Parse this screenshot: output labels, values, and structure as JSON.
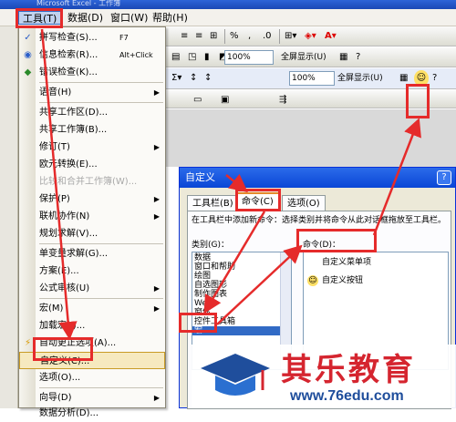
{
  "window": {
    "title": "Microsoft Excel - 工作簿"
  },
  "menubar": {
    "tools": "工具(T)",
    "data": "数据(D)",
    "window": "窗口(W)",
    "help": "帮助(H)"
  },
  "toolbar": {
    "zoom": "100%",
    "fullscreen": "全屏显示(U)"
  },
  "menu": {
    "spelling": {
      "label": "拼写检查(S)...",
      "shortcut": "F7"
    },
    "research": {
      "label": "信息检索(R)...",
      "shortcut": "Alt+Click"
    },
    "error_check": {
      "label": "错误检查(K)..."
    },
    "speech": {
      "label": "语音(H)"
    },
    "shared_workspace": {
      "label": "共享工作区(D)..."
    },
    "share_workbook": {
      "label": "共享工作簿(B)..."
    },
    "track_changes": {
      "label": "修订(T)"
    },
    "ocr": {
      "label": "欧元转换(E)..."
    },
    "compare_merge": {
      "label": "比较和合并工作簿(W)..."
    },
    "protection": {
      "label": "保护(P)"
    },
    "online_collab": {
      "label": "联机协作(N)"
    },
    "solver": {
      "label": "规划求解(V)..."
    },
    "goal_seek": {
      "label": "单变量求解(G)..."
    },
    "scenarios": {
      "label": "方案(E)..."
    },
    "formula_audit": {
      "label": "公式审核(U)"
    },
    "macro": {
      "label": "宏(M)"
    },
    "addins": {
      "label": "加载宏(I)..."
    },
    "autocorrect": {
      "label": "自动更正选项(A)..."
    },
    "customize": {
      "label": "自定义(C)..."
    },
    "options": {
      "label": "选项(O)..."
    },
    "wizard": {
      "label": "向导(D)"
    },
    "data_analysis": {
      "label": "数据分析(D)..."
    }
  },
  "dialog": {
    "title": "自定义",
    "help": "?",
    "tabs": [
      "工具栏(B)",
      "命令(C)",
      "选项(O)"
    ],
    "instruction": "在工具栏中添加新命令：选择类别并将命令从此对话框拖放至工具栏。",
    "categories_label": "类别(G)：",
    "commands_label": "命令(D)：",
    "categories": [
      "数据",
      "窗口和帮助",
      "绘图",
      "自选图形",
      "制作图表",
      "Web",
      "窗体",
      "控件工具箱",
      "宏"
    ],
    "selected_category_index": 8,
    "commands": [
      {
        "icon": "blank-icon",
        "label": "自定义菜单项"
      },
      {
        "icon": "smiley-icon",
        "label": "自定义按钮"
      }
    ]
  },
  "watermark": {
    "brand": "其乐教育",
    "url": "www.76edu.com"
  },
  "colors": {
    "highlight": "#e52b2b",
    "selection": "#316ac5",
    "menu_hover": "#f6e9bf",
    "brand_red": "#d5252f",
    "brand_blue": "#1f4e9c"
  }
}
